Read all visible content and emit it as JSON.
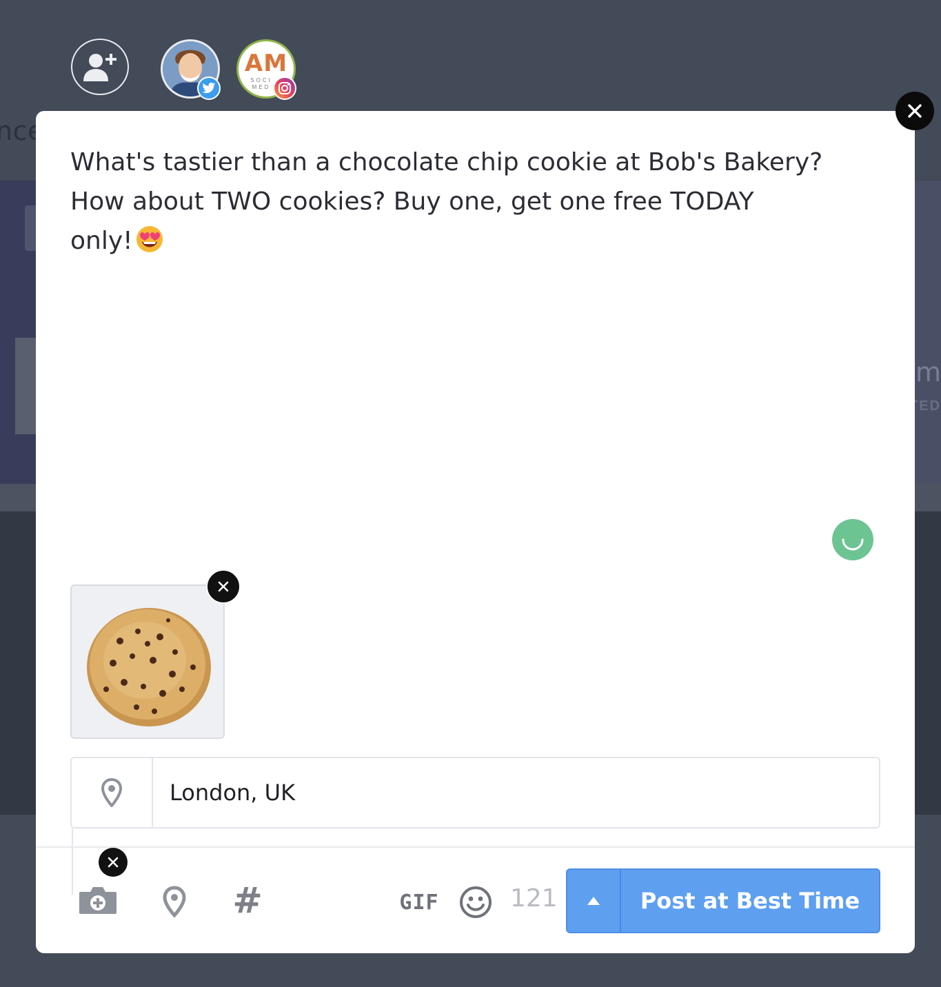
{
  "background": {
    "left_fragment": "nce",
    "right_fragment": "lm",
    "right_sub_fragment": "TED"
  },
  "accounts": {
    "add_label": "add-account",
    "items": [
      {
        "name": "twitter-account",
        "network": "twitter",
        "badge_color": "#3c9ded"
      },
      {
        "name": "instagram-account",
        "network": "instagram",
        "logo_letters": "AM",
        "logo_sub1": "SOCI",
        "logo_sub2": "MED"
      }
    ]
  },
  "composer": {
    "post_text_line1": "What's tastier than a chocolate chip cookie at Bob's Bakery?",
    "post_text_line2": "How about TWO cookies? Buy one, get one free TODAY",
    "post_text_line3": "only!",
    "emoji": "heart-eyes-emoji",
    "location": {
      "value": "London, UK",
      "placeholder": ""
    },
    "attachment": {
      "kind": "image",
      "description_icon": "cookie-image"
    }
  },
  "toolbar": {
    "gif_label": "GIF",
    "hashtag_label": "#",
    "char_count": "121",
    "post_button_label": "Post at Best Time"
  },
  "colors": {
    "accent": "#5e9ff0",
    "spinner": "#6dc493",
    "overlay": "#434a58"
  }
}
